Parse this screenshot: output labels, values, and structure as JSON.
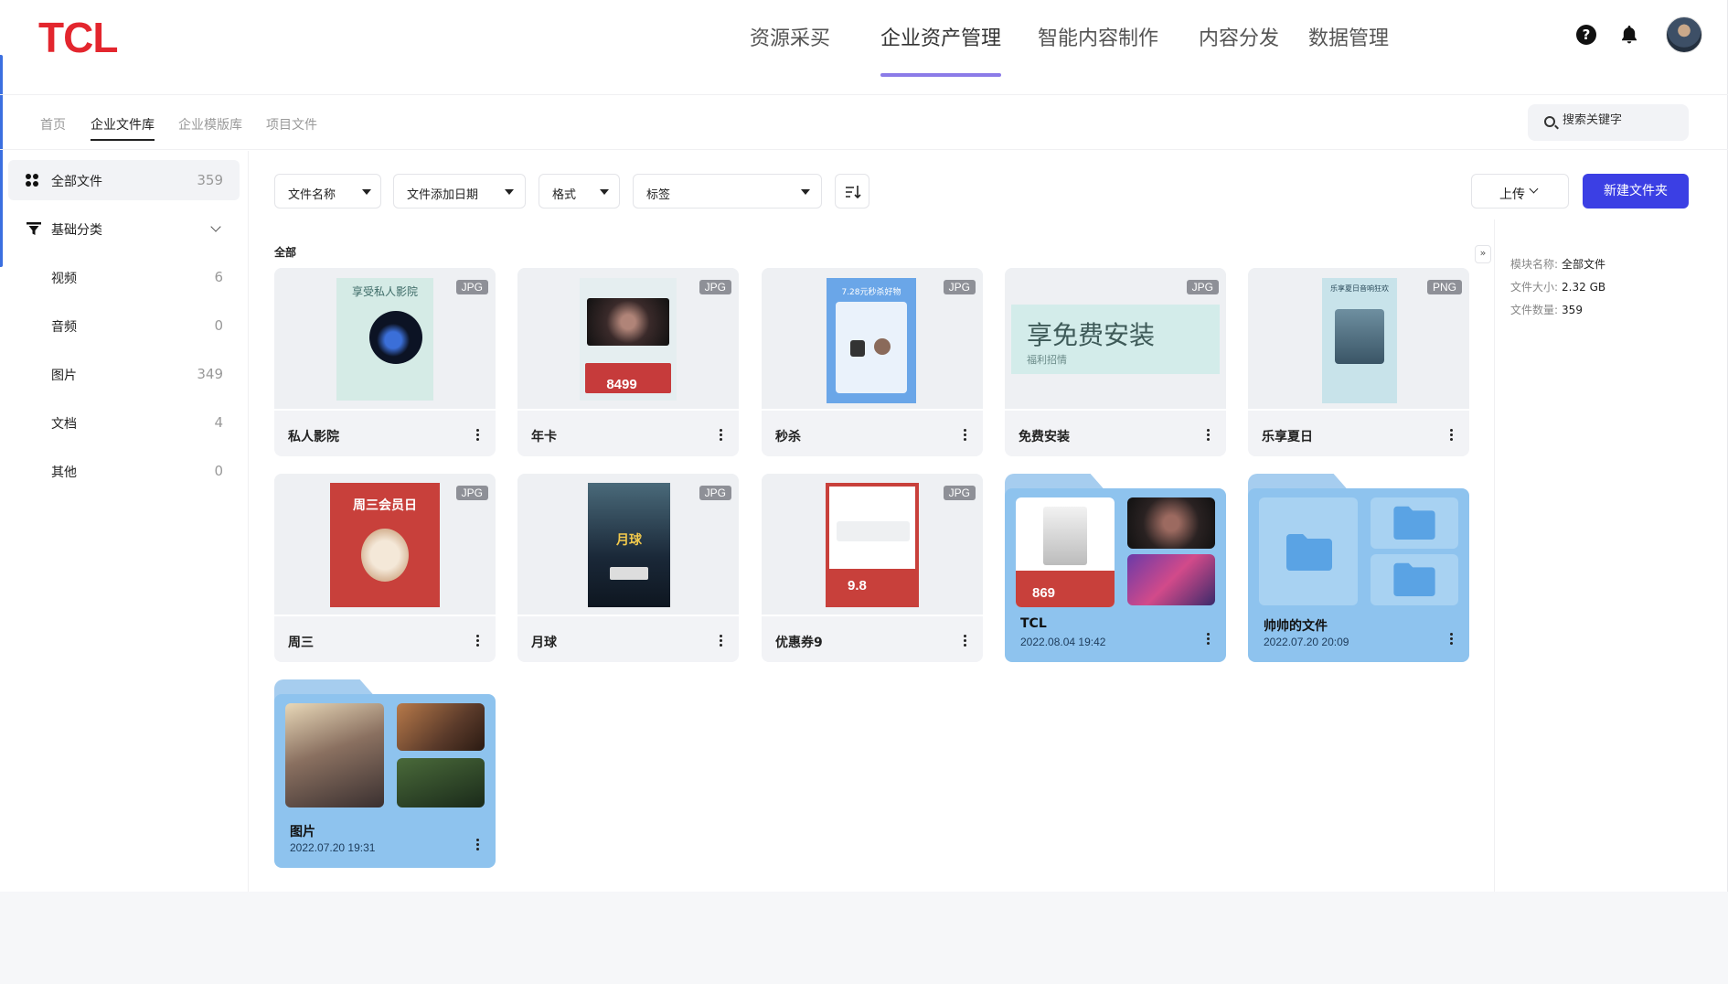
{
  "brand": {
    "logo_text": "TCL",
    "logo_color": "#e3262e",
    "accent": "#3b3fe4",
    "nav_underline_color": "#8b7be8"
  },
  "nav": {
    "items": [
      {
        "label": "资源采买"
      },
      {
        "label": "企业资产管理",
        "active": true
      },
      {
        "label": "智能内容制作"
      },
      {
        "label": "内容分发"
      },
      {
        "label": "数据管理"
      }
    ],
    "help_glyph": "?"
  },
  "breadcrumbs": [
    {
      "label": "首页"
    },
    {
      "label": "企业文件库",
      "active": true
    },
    {
      "label": "企业模版库"
    },
    {
      "label": "项目文件"
    }
  ],
  "search": {
    "placeholder": "搜索关键字"
  },
  "sidebar": {
    "all": {
      "label": "全部文件",
      "count": "359",
      "icon": "grid-icon"
    },
    "category": {
      "label": "基础分类",
      "icon": "filter-icon",
      "expanded": true
    },
    "items": [
      {
        "label": "视频",
        "count": "6"
      },
      {
        "label": "音频",
        "count": "0"
      },
      {
        "label": "图片",
        "count": "349"
      },
      {
        "label": "文档",
        "count": "4"
      },
      {
        "label": "其他",
        "count": "0"
      }
    ]
  },
  "toolbar": {
    "filters": [
      {
        "label": "文件名称"
      },
      {
        "label": "文件添加日期"
      },
      {
        "label": "格式"
      },
      {
        "label": "标签"
      }
    ],
    "upload_label": "上传",
    "new_folder_label": "新建文件夹"
  },
  "section_title": "全部",
  "files": [
    {
      "name": "私人影院",
      "format": "JPG",
      "thumb_text": "享受私人影院"
    },
    {
      "name": "年卡",
      "format": "JPG",
      "thumb_text": "8499"
    },
    {
      "name": "秒杀",
      "format": "JPG",
      "thumb_text": "7.28元秒杀好物"
    },
    {
      "name": "免费安装",
      "format": "JPG",
      "thumb_text": "享免费安装",
      "thumb_sub": "福利招情"
    },
    {
      "name": "乐享夏日",
      "format": "PNG",
      "thumb_text": "乐享夏日音响狂欢"
    },
    {
      "name": "周三",
      "format": "JPG",
      "thumb_text": "周三会员日"
    },
    {
      "name": "月球",
      "format": "JPG",
      "thumb_text": "月球"
    },
    {
      "name": "优惠券9",
      "format": "JPG",
      "thumb_text": "9.8"
    }
  ],
  "folders": [
    {
      "name": "TCL",
      "date": "2022.08.04 19:42",
      "thumb_price": "869"
    },
    {
      "name": "帅帅的文件",
      "date": "2022.07.20 20:09"
    },
    {
      "name": "图片",
      "date": "2022.07.20 19:31"
    }
  ],
  "info_panel": {
    "collapse_glyph": "»",
    "rows": [
      {
        "key": "模块名称:",
        "value": "全部文件"
      },
      {
        "key": "文件大小:",
        "value": "2.32 GB"
      },
      {
        "key": "文件数量:",
        "value": "359"
      }
    ]
  }
}
